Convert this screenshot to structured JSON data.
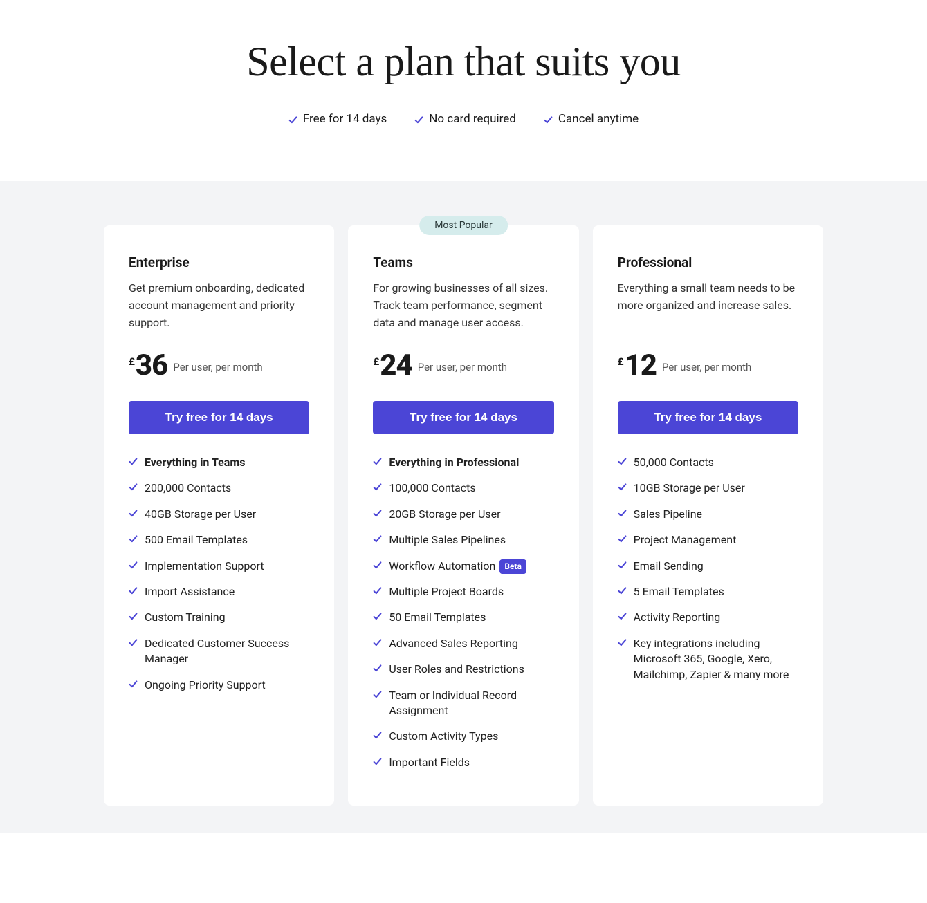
{
  "hero": {
    "title": "Select a plan that suits you",
    "benefits": [
      "Free for 14 days",
      "No card required",
      "Cancel anytime"
    ]
  },
  "popular_badge": "Most Popular",
  "cta_label": "Try free for 14 days",
  "price_unit": "Per user, per month",
  "currency": "£",
  "plans": [
    {
      "id": "enterprise",
      "name": "Enterprise",
      "desc": "Get premium onboarding, dedicated account management and priority support.",
      "price": "36",
      "popular": false,
      "features": [
        {
          "text": "Everything in Teams",
          "bold": true
        },
        {
          "text": "200,000 Contacts"
        },
        {
          "text": "40GB Storage per User"
        },
        {
          "text": "500 Email Templates"
        },
        {
          "text": "Implementation Support"
        },
        {
          "text": "Import Assistance"
        },
        {
          "text": "Custom Training"
        },
        {
          "text": "Dedicated Customer Success Manager"
        },
        {
          "text": "Ongoing Priority Support"
        }
      ]
    },
    {
      "id": "teams",
      "name": "Teams",
      "desc": "For growing businesses of all sizes. Track team performance, segment data and manage user access.",
      "price": "24",
      "popular": true,
      "features": [
        {
          "text": "Everything in Professional",
          "bold": true
        },
        {
          "text": "100,000 Contacts"
        },
        {
          "text": "20GB Storage per User"
        },
        {
          "text": "Multiple Sales Pipelines"
        },
        {
          "text": "Workflow Automation",
          "badge": "Beta"
        },
        {
          "text": "Multiple Project Boards"
        },
        {
          "text": "50 Email Templates"
        },
        {
          "text": "Advanced Sales Reporting"
        },
        {
          "text": "User Roles and Restrictions"
        },
        {
          "text": "Team or Individual Record Assignment"
        },
        {
          "text": "Custom Activity Types"
        },
        {
          "text": "Important Fields"
        }
      ]
    },
    {
      "id": "professional",
      "name": "Professional",
      "desc": "Everything a small team needs to be more organized and increase sales.",
      "price": "12",
      "popular": false,
      "features": [
        {
          "text": "50,000 Contacts"
        },
        {
          "text": "10GB Storage per User"
        },
        {
          "text": "Sales Pipeline"
        },
        {
          "text": "Project Management"
        },
        {
          "text": "Email Sending"
        },
        {
          "text": "5 Email Templates"
        },
        {
          "text": "Activity Reporting"
        },
        {
          "text": "Key integrations including Microsoft 365, Google, Xero, Mailchimp, Zapier & many more"
        }
      ]
    }
  ]
}
